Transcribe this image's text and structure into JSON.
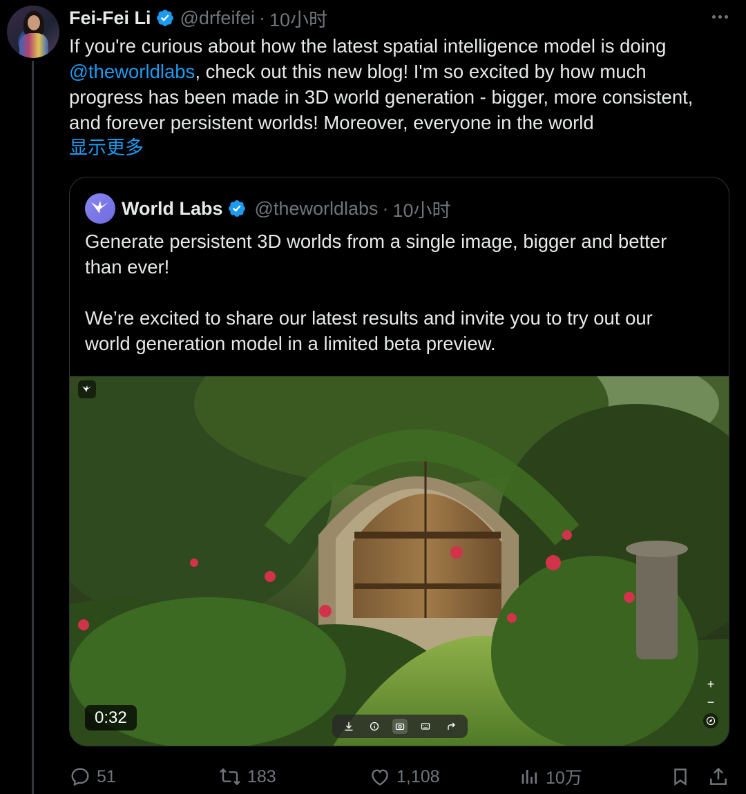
{
  "author": {
    "name": "Fei-Fei Li",
    "handle": "@drfeifei",
    "time": "10小时",
    "separator": "·"
  },
  "tweet": {
    "line1": "If you're curious about how the latest spatial intelligence model is doing",
    "mention": "@theworldlabs",
    "line2_rest": ", check out this new blog! I'm so excited by how much",
    "line3": "progress has been made in 3D world generation - bigger, more consistent,",
    "line4": "and forever persistent worlds! Moreover, everyone in the world",
    "show_more": "显示更多"
  },
  "quote": {
    "name": "World Labs",
    "handle": "@theworldlabs",
    "time": "10小时",
    "separator": "·",
    "para1_line1": "Generate persistent 3D worlds from a single image, bigger and better",
    "para1_line2": "than ever!",
    "para2_line1": "We’re excited to share our latest results and invite you to try out our",
    "para2_line2": "world generation model in a limited beta preview.",
    "media": {
      "duration": "0:32",
      "zoom_in": "+",
      "zoom_out": "−"
    }
  },
  "actions": {
    "replies": "51",
    "reposts": "183",
    "likes": "1,108",
    "views": "10万"
  },
  "colors": {
    "background": "#000000",
    "text": "#e7e9ea",
    "muted": "#71767b",
    "link": "#1d9bf0",
    "verified": "#1d9bf0",
    "border": "#2f3336"
  },
  "icons": [
    "more-icon",
    "verified-badge-icon",
    "reply-icon",
    "repost-icon",
    "like-icon",
    "views-icon",
    "bookmark-icon",
    "share-icon",
    "download-icon",
    "info-icon",
    "camera-icon",
    "keyboard-icon",
    "redo-icon",
    "compass-icon",
    "worldlabs-logo-icon"
  ]
}
